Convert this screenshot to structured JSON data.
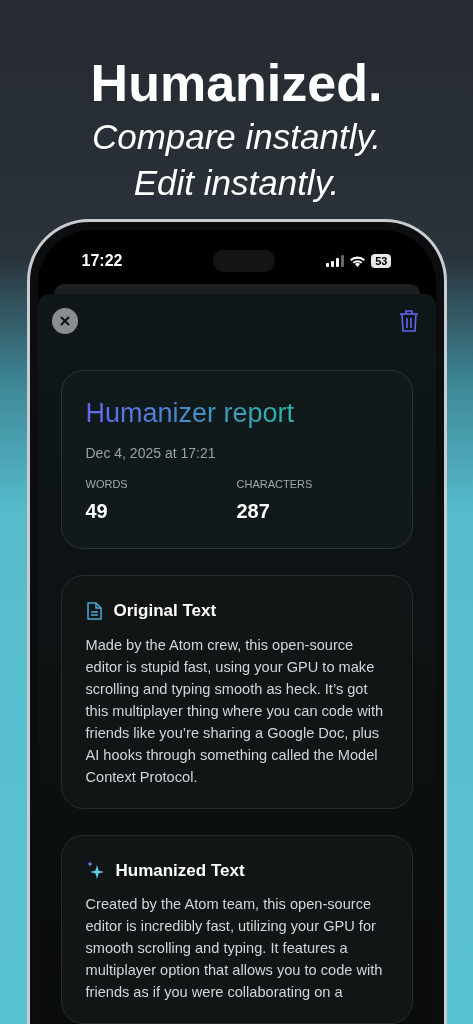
{
  "headline": {
    "title": "Humanized.",
    "subtitle_lines": [
      "Compare instantly.",
      "Edit instantly."
    ]
  },
  "status_bar": {
    "time": "17:22",
    "battery": "53"
  },
  "report": {
    "title": "Humanizer report",
    "date": "Dec 4, 2025 at 17:21",
    "stats": [
      {
        "label": "WORDS",
        "value": "49"
      },
      {
        "label": "CHARACTERS",
        "value": "287"
      }
    ]
  },
  "sections": [
    {
      "kind": "original",
      "title": "Original Text",
      "text": "Made by the Atom crew, this open-source editor is stupid fast, using your GPU to make scrolling and typing smooth as heck. It’s got this multiplayer thing where you can code with friends like you’re sharing a Google Doc, plus AI hooks through something called the Model Context Protocol."
    },
    {
      "kind": "humanized",
      "title": "Humanized Text",
      "text": "Created by the Atom team, this open-source editor is incredibly fast, utilizing your GPU for smooth scrolling and typing. It features a multiplayer option that allows you to code with friends as if you were collaborating on a"
    }
  ]
}
